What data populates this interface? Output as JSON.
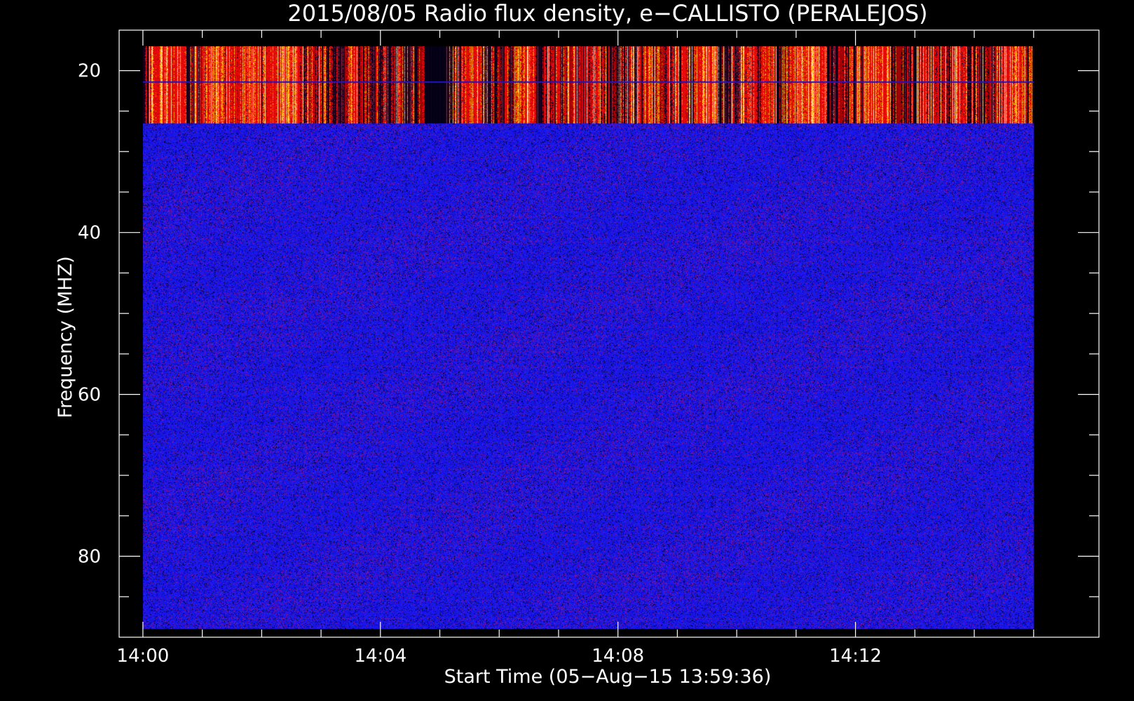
{
  "chart_data": {
    "type": "heatmap",
    "title": "2015/08/05  Radio flux density, e−CALLISTO (PERALEJOS)",
    "xlabel": "Start Time (05−Aug−15 13:59:36)",
    "ylabel": "Frequency (MHZ)",
    "x_start": "14:00",
    "x_end": "14:15",
    "xlim_minutes": [
      -0.4,
      16.1
    ],
    "ylim_mhz": [
      90,
      15
    ],
    "data_x_range_minutes": [
      0,
      15
    ],
    "data_y_range_mhz": [
      17,
      89
    ],
    "x_ticks": [
      {
        "label": "14:00",
        "minute": 0
      },
      {
        "label": "14:04",
        "minute": 4
      },
      {
        "label": "14:08",
        "minute": 8
      },
      {
        "label": "14:12",
        "minute": 12
      }
    ],
    "x_minor_tick_minutes": [
      1,
      2,
      3,
      5,
      6,
      7,
      9,
      10,
      11,
      13,
      14,
      15
    ],
    "y_ticks": [
      {
        "label": "20",
        "mhz": 20
      },
      {
        "label": "40",
        "mhz": 40
      },
      {
        "label": "60",
        "mhz": 60
      },
      {
        "label": "80",
        "mhz": 80
      }
    ],
    "y_minor_tick_mhz": [
      25,
      30,
      35,
      45,
      50,
      55,
      65,
      70,
      75,
      85
    ],
    "bands": [
      {
        "range_mhz": [
          17,
          26.5
        ],
        "level": "high",
        "description_colors": [
          "#ff2200",
          "#ffcc00",
          "#ffffaa"
        ]
      },
      {
        "range_mhz": [
          26.5,
          89
        ],
        "level": "low",
        "description_colors": [
          "#1010ff",
          "#000066",
          "#7a1a7a"
        ]
      }
    ],
    "colormap": [
      "#000000",
      "#0000ff",
      "#7f1f7f",
      "#ff0000",
      "#ffbb00",
      "#ffffcc"
    ],
    "grid": false,
    "legend": "none"
  }
}
